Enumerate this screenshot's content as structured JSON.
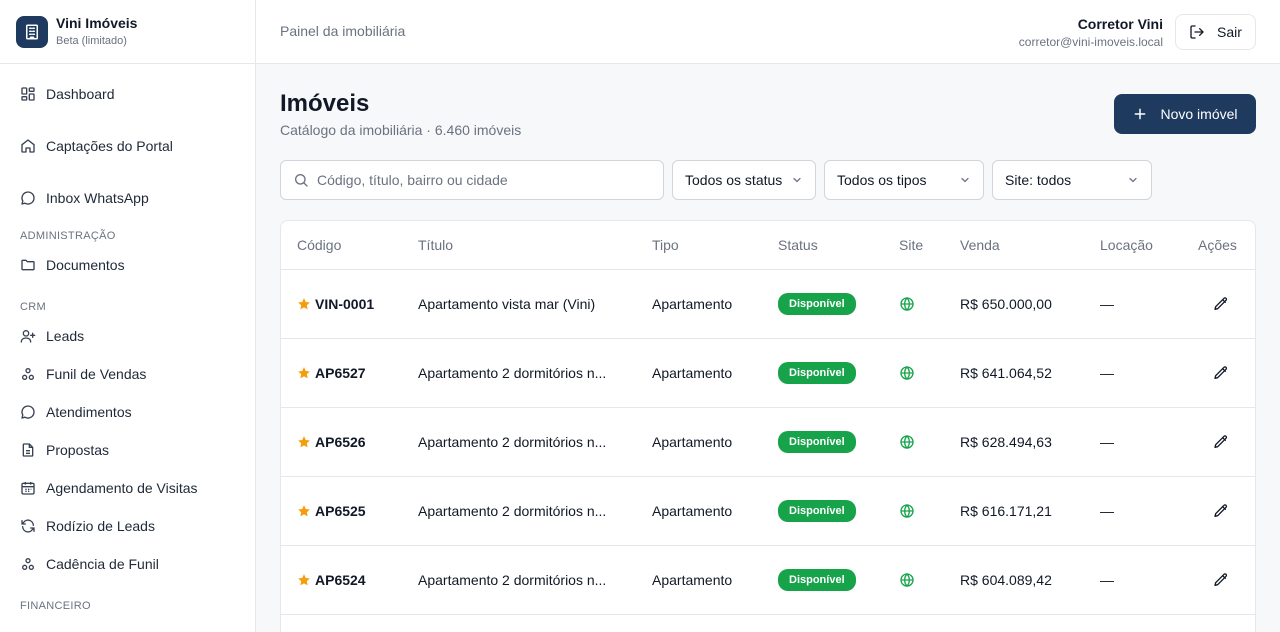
{
  "brand": {
    "name": "Vini Imóveis",
    "subtitle": "Beta (limitado)"
  },
  "sidebar": {
    "items_top": [
      {
        "label": "Dashboard",
        "icon": "dashboard-icon"
      },
      {
        "label": "Captações do Portal",
        "icon": "home-icon"
      },
      {
        "label": "Inbox WhatsApp",
        "icon": "chat-icon"
      }
    ],
    "sections": [
      {
        "title": "ADMINISTRAÇÃO",
        "items": [
          {
            "label": "Documentos",
            "icon": "folder-icon"
          }
        ]
      },
      {
        "title": "CRM",
        "items": [
          {
            "label": "Leads",
            "icon": "user-plus-icon"
          },
          {
            "label": "Funil de Vendas",
            "icon": "network-icon"
          },
          {
            "label": "Atendimentos",
            "icon": "chat-icon"
          },
          {
            "label": "Propostas",
            "icon": "document-icon"
          },
          {
            "label": "Agendamento de Visitas",
            "icon": "calendar-icon"
          },
          {
            "label": "Rodízio de Leads",
            "icon": "refresh-icon"
          },
          {
            "label": "Cadência de Funil",
            "icon": "network-icon"
          }
        ]
      },
      {
        "title": "FINANCEIRO",
        "items": []
      }
    ]
  },
  "header": {
    "title": "Painel da imobiliária",
    "user_name": "Corretor Vini",
    "user_email": "corretor@vini-imoveis.local",
    "logout_label": "Sair"
  },
  "page": {
    "title": "Imóveis",
    "subtitle": "Catálogo da imobiliária · 6.460 imóveis",
    "new_button": "Novo imóvel"
  },
  "filters": {
    "search_placeholder": "Código, título, bairro ou cidade",
    "status": "Todos os status",
    "type": "Todos os tipos",
    "site": "Site: todos"
  },
  "table": {
    "headers": {
      "code": "Código",
      "title": "Título",
      "type": "Tipo",
      "status": "Status",
      "site": "Site",
      "sale": "Venda",
      "rent": "Locação",
      "actions": "Ações"
    },
    "rows": [
      {
        "code": "VIN-0001",
        "title": "Apartamento vista mar (Vini)",
        "type": "Apartamento",
        "status": "Disponível",
        "sale": "R$ 650.000,00",
        "rent": "—"
      },
      {
        "code": "AP6527",
        "title": "Apartamento 2 dormitórios n...",
        "type": "Apartamento",
        "status": "Disponível",
        "sale": "R$ 641.064,52",
        "rent": "—"
      },
      {
        "code": "AP6526",
        "title": "Apartamento 2 dormitórios n...",
        "type": "Apartamento",
        "status": "Disponível",
        "sale": "R$ 628.494,63",
        "rent": "—"
      },
      {
        "code": "AP6525",
        "title": "Apartamento 2 dormitórios n...",
        "type": "Apartamento",
        "status": "Disponível",
        "sale": "R$ 616.171,21",
        "rent": "—"
      },
      {
        "code": "AP6524",
        "title": "Apartamento 2 dormitórios n...",
        "type": "Apartamento",
        "status": "Disponível",
        "sale": "R$ 604.089,42",
        "rent": "—"
      }
    ]
  },
  "colors": {
    "primary": "#1e3a5f",
    "success": "#16a34a",
    "star": "#f59e0b"
  }
}
